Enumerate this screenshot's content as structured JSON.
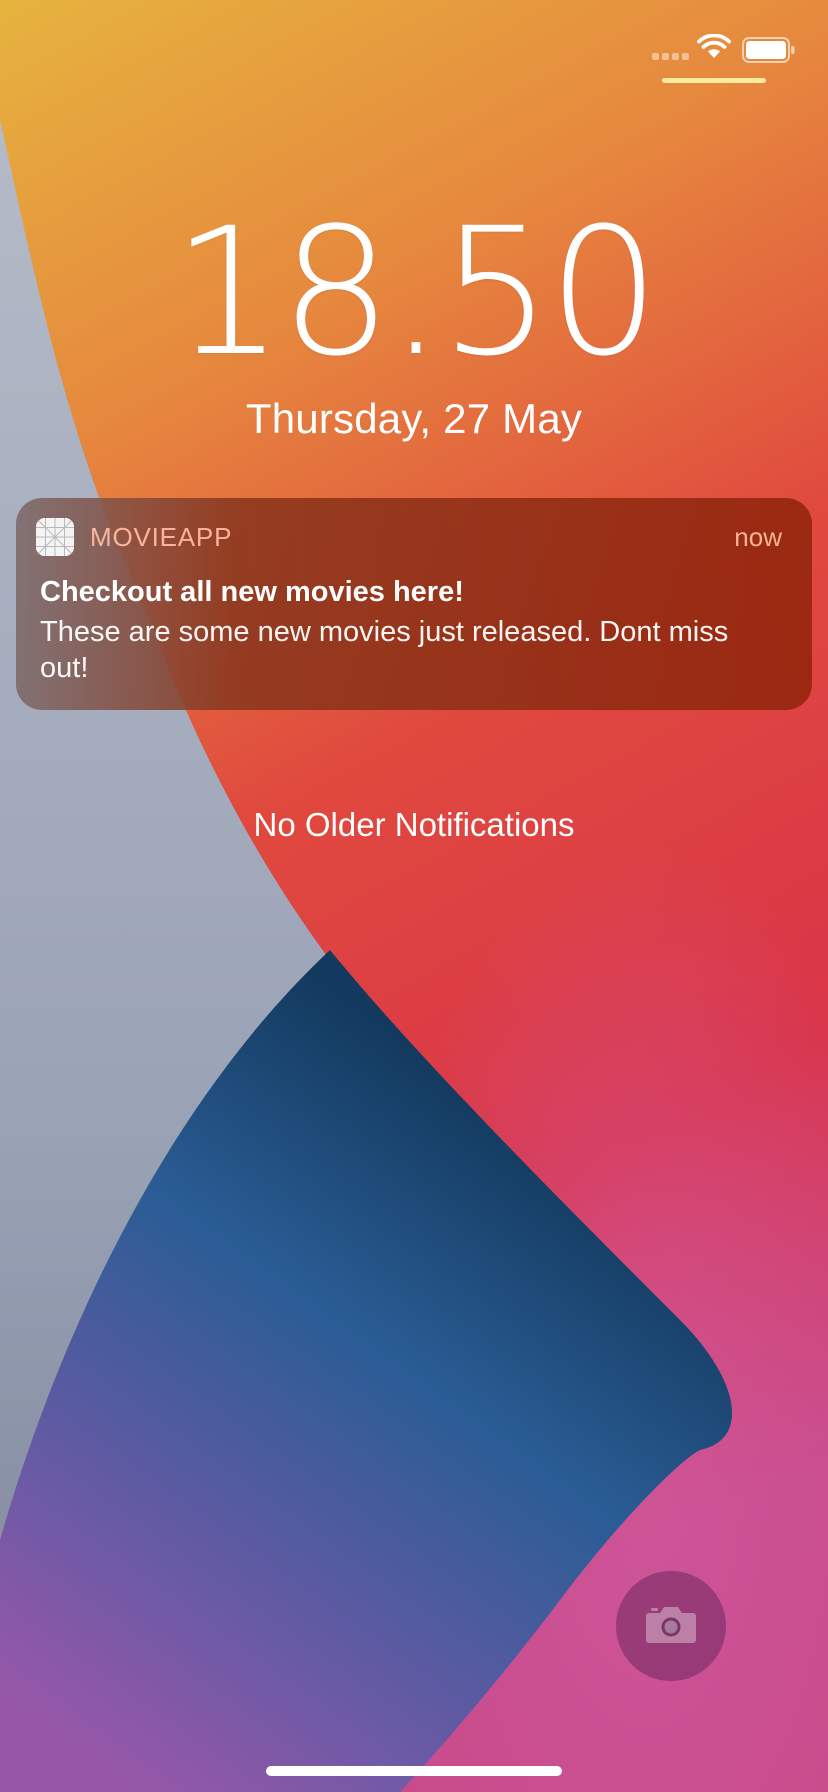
{
  "status_bar": {
    "wifi_icon": "wifi-icon",
    "battery_icon": "battery-icon",
    "battery_level": 1.0
  },
  "lock_screen": {
    "time": "18.50",
    "date": "Thursday, 27 May"
  },
  "notification": {
    "app_icon": "movieapp-icon",
    "app_name": "MOVIEAPP",
    "time": "now",
    "title": "Checkout all new movies here!",
    "body": "These are some new movies just released. Dont miss out!"
  },
  "empty_state": "No Older Notifications",
  "camera_icon": "camera-icon",
  "colors": {
    "wallpaper_top": "#E6B03E",
    "wallpaper_orange": "#E67A3A",
    "wallpaper_red": "#DC3A42",
    "wallpaper_grey": "#A3ACBD",
    "wallpaper_blue": "#2B5A92",
    "wallpaper_purple": "#8A58AA",
    "notification_bg": "#962A12"
  }
}
